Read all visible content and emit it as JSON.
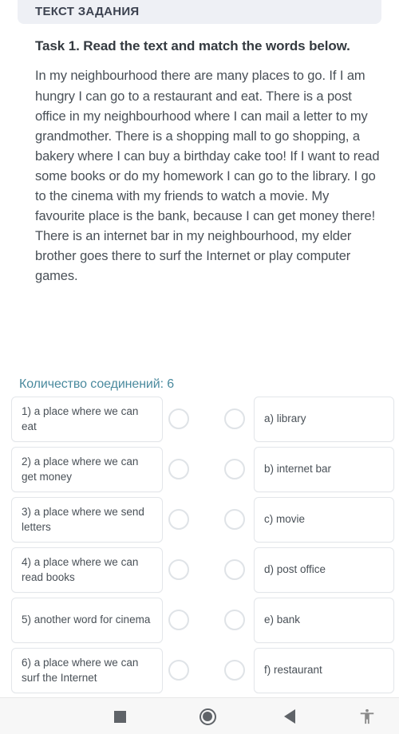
{
  "header": {
    "title": "ТЕКСТ ЗАДАНИЯ"
  },
  "task": {
    "title": "Task 1. Read the text and match the words below.",
    "text": "In my neighbourhood there are many places to go. If I am hungry I can go to a restaurant and eat. There is a post office in my neighbourhood where I can mail a letter to my grandmother. There is a shopping mall to go shopping, a bakery where I can buy a birthday cake too! If I want to read some books or do my homework I can go to the library. I go to the cinema with my friends to watch a movie. My favourite place is the bank, because I can get money there! There is an internet bar in my neighbourhood, my elder brother goes there to surf the Internet or play computer games."
  },
  "connections": {
    "label": "Количество соединений: 6",
    "count": 6,
    "color": "#4a8a9e"
  },
  "match": {
    "rows": [
      {
        "left": "1) a place where we can eat",
        "right": "a) library"
      },
      {
        "left": "2) a place where we can get money",
        "right": "b) internet bar"
      },
      {
        "left": "3) a place where we send letters",
        "right": "c) movie"
      },
      {
        "left": "4) a place where we can read books",
        "right": "d) post office"
      },
      {
        "left": "5) another word for cinema",
        "right": "e) bank"
      },
      {
        "left": "6) a place where we can surf the Internet",
        "right": "f) restaurant"
      }
    ]
  },
  "navbar": {
    "recents": "recents-square-icon",
    "home": "home-circle-icon",
    "back": "back-triangle-icon",
    "accessibility": "accessibility-icon"
  }
}
